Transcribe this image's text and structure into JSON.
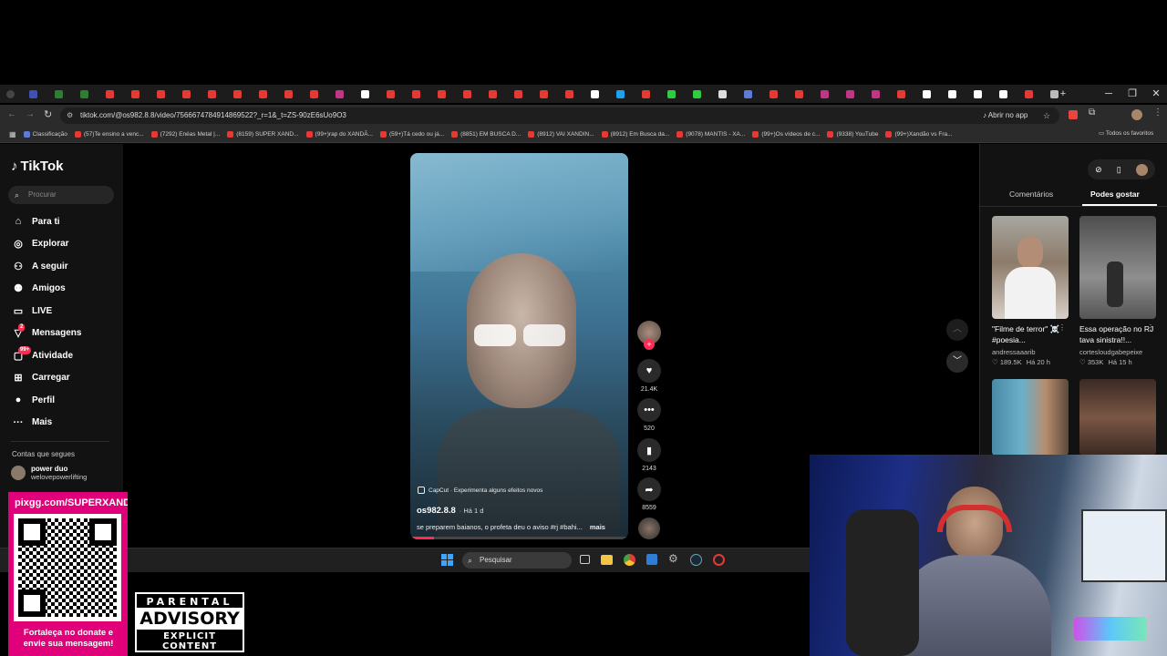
{
  "browser": {
    "url": "tiktok.com/@os982.8.8/video/7566674784914869522?_r=1&_t=ZS-90zE6sUo9O3",
    "open_in_app": "Abrir no app",
    "bookmarks": [
      "Classificação",
      "(57)Te ensino a venc...",
      "(7292) Enéas Metal |...",
      "(8159) SUPER XAND...",
      "(99+)rap do XANDÃ...",
      "(59+)Tá cedo ou já...",
      "(8851) EM BUSCA D...",
      "(8912) VAI XANDIN...",
      "(8912) Em Busca da...",
      "(9078) MANTIS - XA...",
      "(99+)Os vídeos de c...",
      "(9338) YouTube",
      "(99+)Xandão vs Fra..."
    ],
    "all_bookmarks": "Todos os favoritos"
  },
  "tiktok": {
    "logo": "TikTok",
    "search_placeholder": "Procurar",
    "nav": [
      {
        "label": "Para ti",
        "icon": "home-icon"
      },
      {
        "label": "Explorar",
        "icon": "compass-icon"
      },
      {
        "label": "A seguir",
        "icon": "following-icon"
      },
      {
        "label": "Amigos",
        "icon": "friends-icon"
      },
      {
        "label": "LIVE",
        "icon": "live-icon"
      },
      {
        "label": "Mensagens",
        "icon": "messages-icon",
        "badge": "2"
      },
      {
        "label": "Atividade",
        "icon": "activity-icon",
        "badge": "99+"
      },
      {
        "label": "Carregar",
        "icon": "upload-icon"
      },
      {
        "label": "Perfil",
        "icon": "profile-icon"
      },
      {
        "label": "Mais",
        "icon": "more-icon"
      }
    ],
    "following_header": "Contas que segues",
    "following": [
      {
        "name": "power duo",
        "handle": "welovepowerlifting"
      }
    ],
    "video": {
      "capcut": "CapCut · Experimenta alguns efeitos novos",
      "author": "os982.8.8",
      "time": "· Há 1 d",
      "caption": "se preparem baianos, o profeta deu o aviso #rj #bahi...",
      "more": "mais"
    },
    "actions": {
      "likes": "21.4K",
      "comments": "520",
      "saves": "2143",
      "shares": "8559"
    },
    "right_panel": {
      "tab_comments": "Comentários",
      "tab_recommended": "Podes gostar",
      "recommendations": [
        {
          "title": "\"Filme de terror\" ☠️ #poesia...",
          "author": "andressaaarib",
          "likes": "189.5K",
          "time": "Há 20 h"
        },
        {
          "title": "Essa operação no RJ tava sinistra!!...",
          "author": "cortesloudgabepeixe",
          "likes": "353K",
          "time": "Há 15 h"
        }
      ]
    }
  },
  "taskbar": {
    "search_placeholder": "Pesquisar"
  },
  "overlay": {
    "qr_url": "pixgg.com/SUPERXANDA",
    "qr_caption": "Fortaleça no donate e envie sua mensagem!",
    "advisory_top": "PARENTAL",
    "advisory_mid": "ADVISORY",
    "advisory_bottom": "EXPLICIT CONTENT"
  },
  "colors": {
    "accent": "#fe2c55",
    "qr_bg": "#e0007a",
    "background": "#000000"
  }
}
